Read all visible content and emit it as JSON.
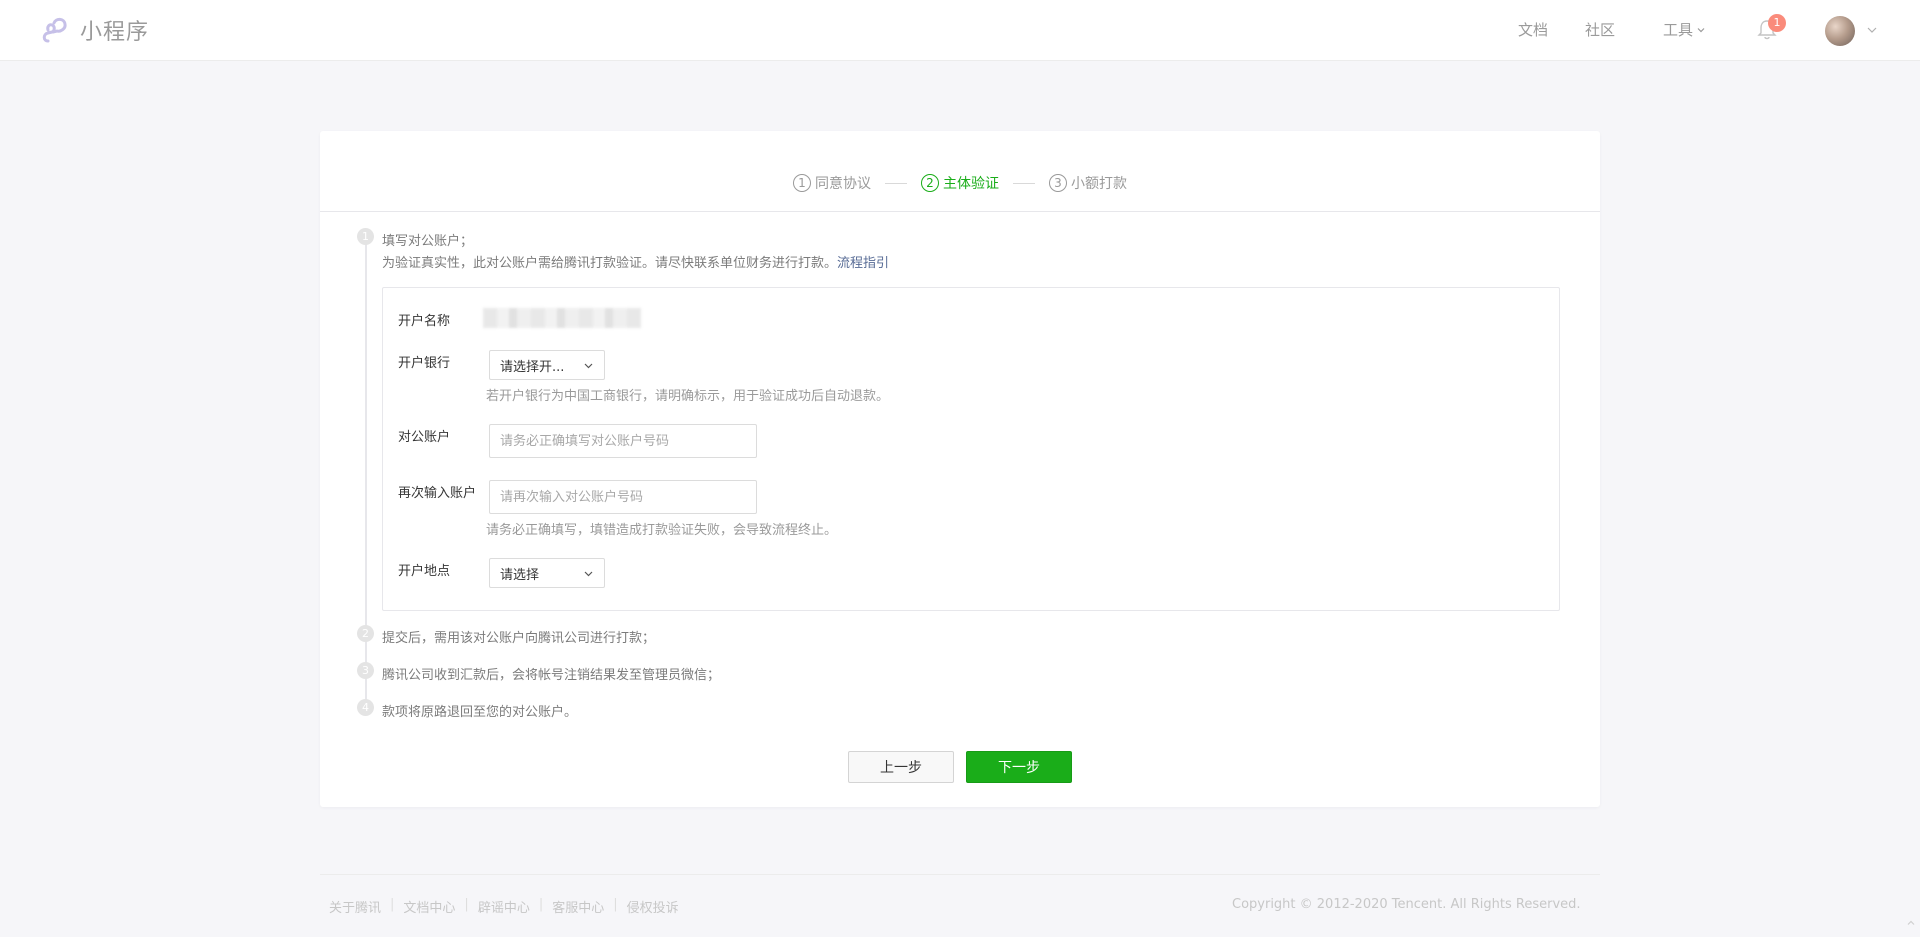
{
  "header": {
    "app_name": "小程序",
    "nav": {
      "docs": "文档",
      "community": "社区",
      "tools": "工具"
    },
    "notification_count": "1"
  },
  "steps": [
    {
      "num": "1",
      "label": "同意协议"
    },
    {
      "num": "2",
      "label": "主体验证"
    },
    {
      "num": "3",
      "label": "小额打款"
    }
  ],
  "active_step": 2,
  "timeline": {
    "item1": {
      "num": "1",
      "title": "填写对公账户；",
      "desc": "为验证真实性，此对公账户需给腾讯打款验证。请尽快联系单位财务进行打款。",
      "link": "流程指引"
    },
    "item2": {
      "num": "2",
      "text": "提交后，需用该对公账户向腾讯公司进行打款；"
    },
    "item3": {
      "num": "3",
      "text": "腾讯公司收到汇款后，会将帐号注销结果发至管理员微信；"
    },
    "item4": {
      "num": "4",
      "text": "款项将原路退回至您的对公账户。"
    }
  },
  "form": {
    "account_name_label": "开户名称",
    "bank_label": "开户银行",
    "bank_select": "请选择开...",
    "bank_hint": "若开户银行为中国工商银行，请明确标示，用于验证成功后自动退款。",
    "account_label": "对公账户",
    "account_placeholder": "请务必正确填写对公账户号码",
    "account_confirm_label": "再次输入账户",
    "account_confirm_placeholder": "请再次输入对公账户号码",
    "account_hint": "请务必正确填写，填错造成打款验证失败，会导致流程终止。",
    "location_label": "开户地点",
    "location_select": "请选择"
  },
  "buttons": {
    "prev": "上一步",
    "next": "下一步"
  },
  "footer": {
    "links": [
      "关于腾讯",
      "文档中心",
      "辟谣中心",
      "客服中心",
      "侵权投诉"
    ],
    "copyright": "Copyright © 2012-2020 Tencent. All Rights Reserved."
  },
  "colors": {
    "primary": "#1aad19",
    "link": "#576b95",
    "badge": "#fa8b7b"
  }
}
